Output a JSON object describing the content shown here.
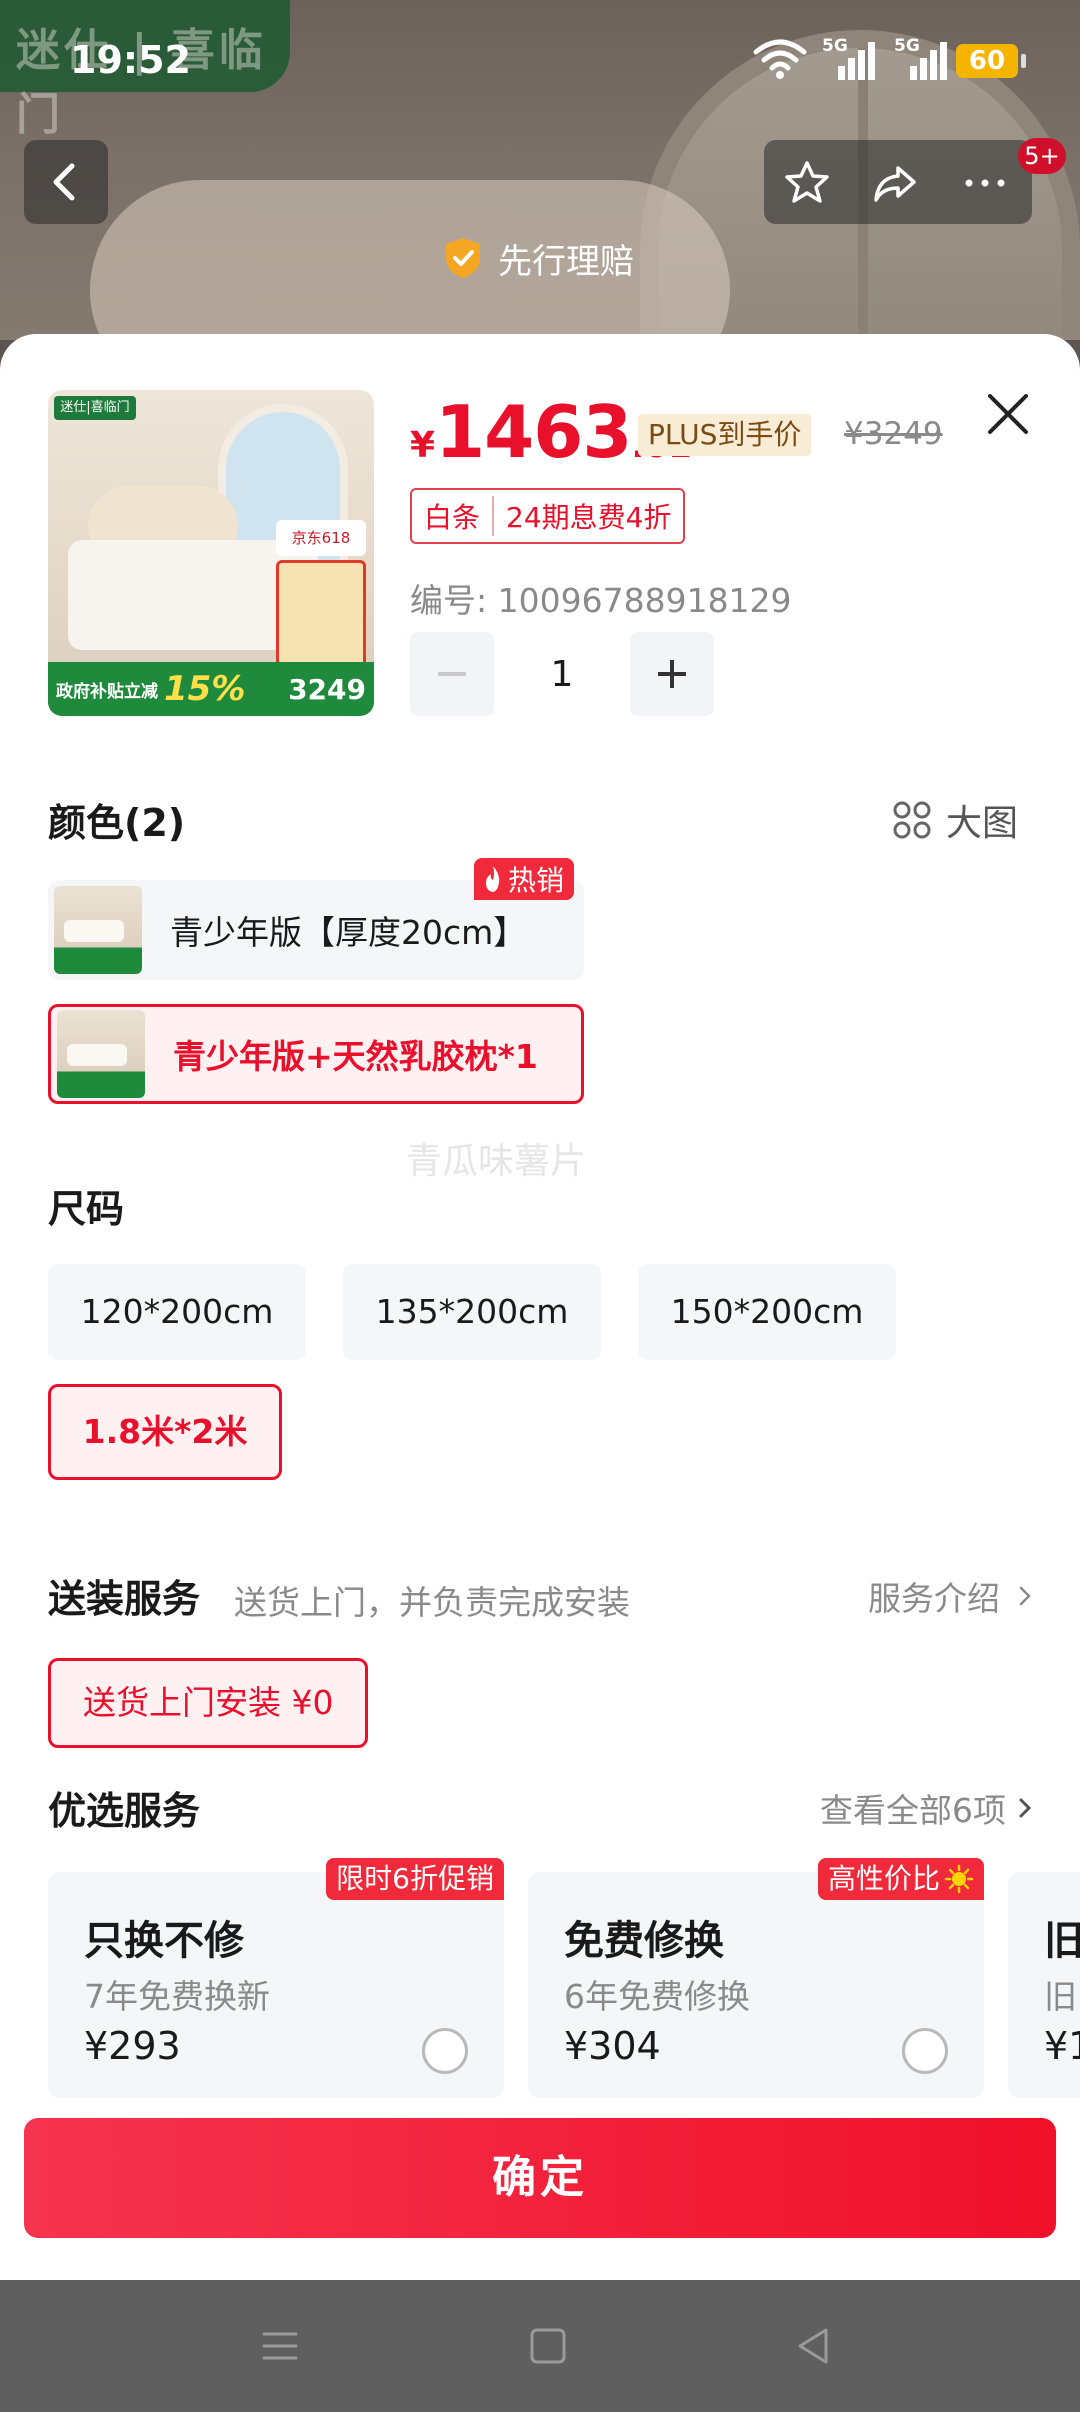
{
  "status_bar": {
    "time": "19:52",
    "battery": "60",
    "network_1": "5G",
    "network_2": "5G"
  },
  "background": {
    "brand_logo": "迷仕 | 喜临门",
    "claim_label": "先行理赔",
    "more_badge": "5+"
  },
  "product": {
    "price_symbol": "¥",
    "price_integer": "1463",
    "price_decimal": ".01",
    "plus_label": "PLUS到手价",
    "original_price": "¥3249",
    "installment_left": "白条",
    "installment_right": "24期息费4折",
    "sku": "编号: 10096788918129",
    "quantity": "1",
    "thumb_bar_left": "政府补贴立减",
    "thumb_bar_percent": "15%",
    "thumb_bar_price": "3249",
    "thumb_tag": "京东618"
  },
  "color_section": {
    "title": "颜色(2)",
    "big_view_label": "大图",
    "hot_tag": "热销",
    "options": [
      {
        "label": "青少年版【厚度20cm】",
        "selected": false
      },
      {
        "label": "青少年版+天然乳胶枕*1",
        "selected": true
      }
    ]
  },
  "watermark": "青瓜味薯片",
  "size_section": {
    "title": "尺码",
    "options": [
      {
        "label": "120*200cm",
        "selected": false
      },
      {
        "label": "135*200cm",
        "selected": false
      },
      {
        "label": "150*200cm",
        "selected": false
      },
      {
        "label": "1.8米*2米",
        "selected": true
      }
    ]
  },
  "delivery_section": {
    "title": "送装服务",
    "subtitle": "送货上门，并负责完成安装",
    "link": "服务介绍",
    "option": "送货上门安装  ¥0"
  },
  "optional_section": {
    "title": "优选服务",
    "link": "查看全部6项",
    "cards": [
      {
        "tag": "限时6折促销",
        "title": "只换不修",
        "subtitle": "7年免费换新",
        "price": "¥293"
      },
      {
        "tag": "高性价比",
        "title": "免费修换",
        "subtitle": "6年免费修换",
        "price": "¥304"
      },
      {
        "tag": "",
        "title": "旧",
        "subtitle": "旧",
        "price": "¥1"
      }
    ]
  },
  "confirm_label": "确定",
  "colors": {
    "accent": "#e8102b",
    "option_bg": "#f5f6f8",
    "selected_bg": "#fff0f2",
    "plus_bg": "#f8ecd6"
  }
}
